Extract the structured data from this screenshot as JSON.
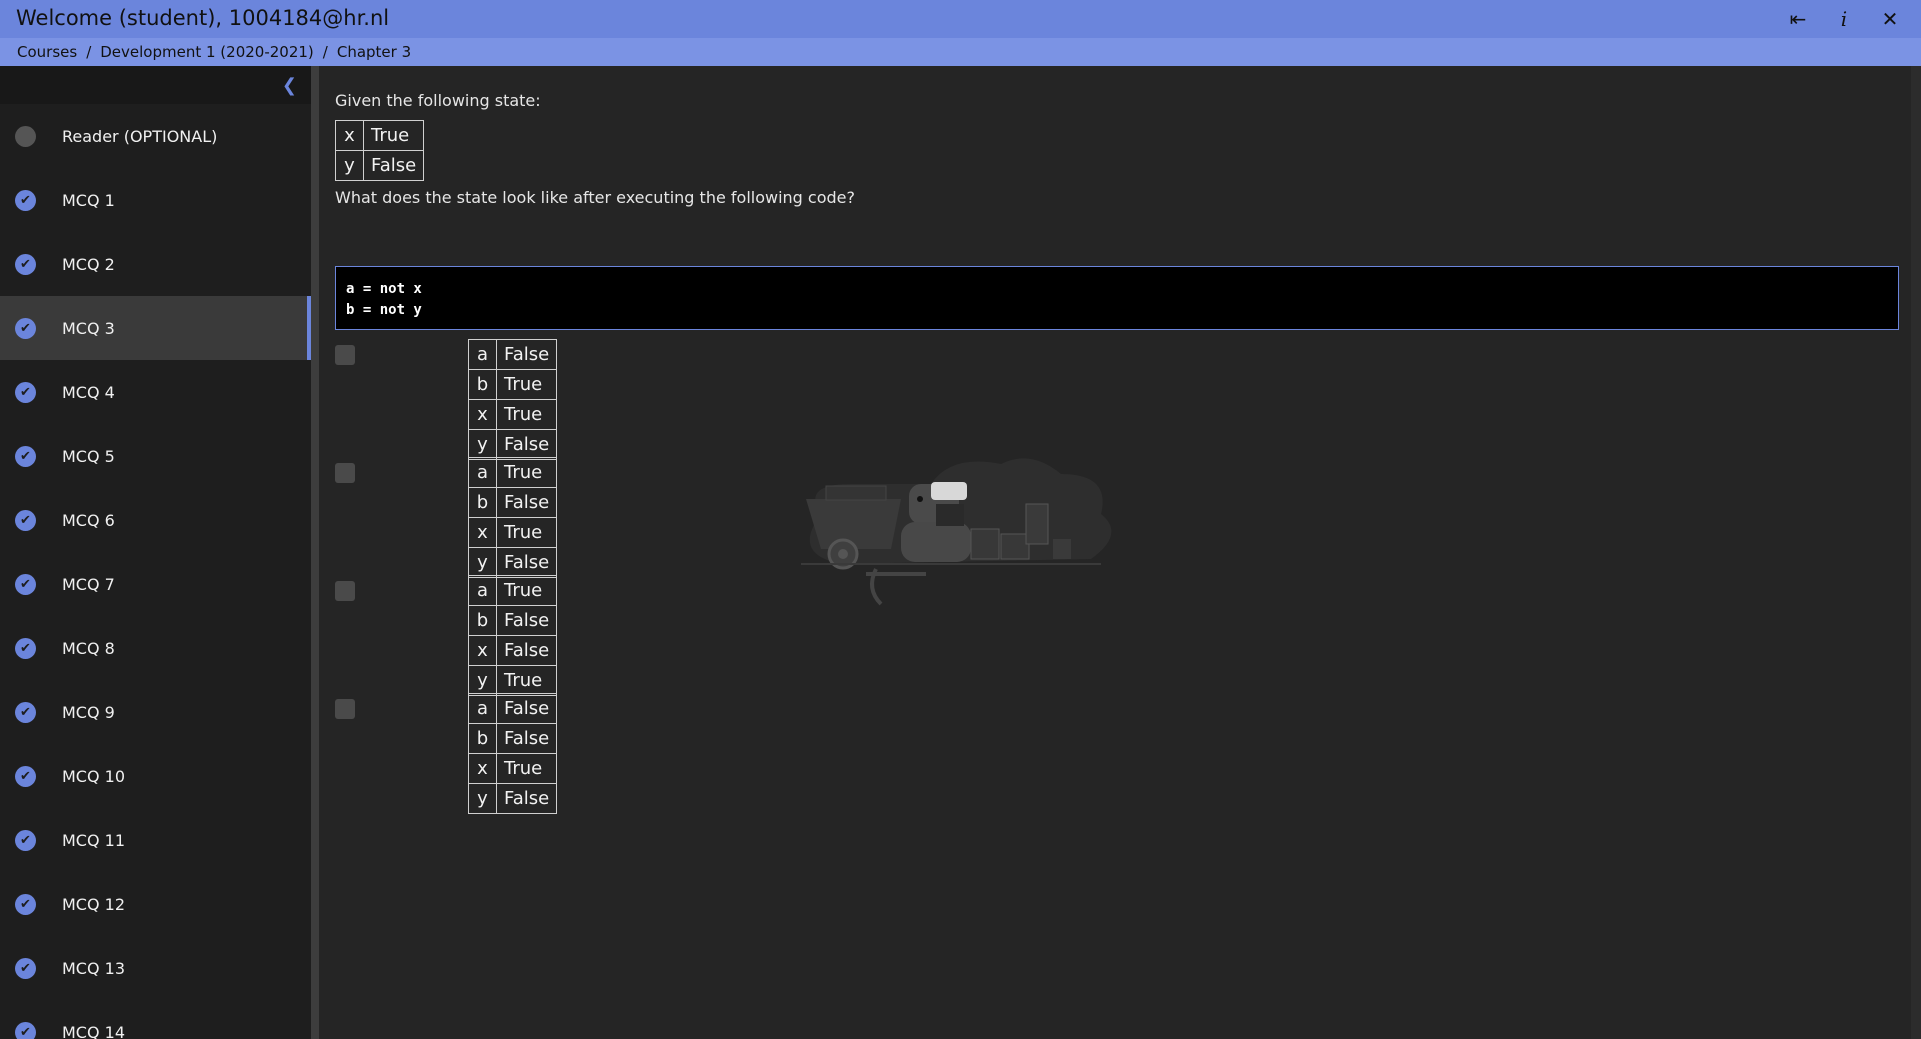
{
  "window": {
    "title": "Welcome (student), 1004184@hr.nl",
    "logout_icon": "logout-icon",
    "info_icon": "info-icon",
    "close_icon": "close-icon"
  },
  "breadcrumb": {
    "items": [
      "Courses",
      "Development 1 (2020-2021)",
      "Chapter 3"
    ],
    "separator": "/"
  },
  "sidebar": {
    "collapse_icon": "chevron-left-icon",
    "items": [
      {
        "label": "Reader (OPTIONAL)",
        "status": "todo"
      },
      {
        "label": "MCQ 1",
        "status": "done"
      },
      {
        "label": "MCQ 2",
        "status": "done"
      },
      {
        "label": "MCQ 3",
        "status": "done",
        "active": true
      },
      {
        "label": "MCQ 4",
        "status": "done"
      },
      {
        "label": "MCQ 5",
        "status": "done"
      },
      {
        "label": "MCQ 6",
        "status": "done"
      },
      {
        "label": "MCQ 7",
        "status": "done"
      },
      {
        "label": "MCQ 8",
        "status": "done"
      },
      {
        "label": "MCQ 9",
        "status": "done"
      },
      {
        "label": "MCQ 10",
        "status": "done"
      },
      {
        "label": "MCQ 11",
        "status": "done"
      },
      {
        "label": "MCQ 12",
        "status": "done"
      },
      {
        "label": "MCQ 13",
        "status": "done"
      },
      {
        "label": "MCQ 14",
        "status": "done"
      }
    ]
  },
  "question": {
    "intro": "Given the following state:",
    "initial_state": [
      [
        "x",
        "True"
      ],
      [
        "y",
        "False"
      ]
    ],
    "prompt": "What does the state look like after executing the following code?",
    "code_lines": [
      "a = not x",
      "b = not y"
    ],
    "options": [
      [
        [
          "a",
          "False"
        ],
        [
          "b",
          "True"
        ],
        [
          "x",
          "True"
        ],
        [
          "y",
          "False"
        ]
      ],
      [
        [
          "a",
          "True"
        ],
        [
          "b",
          "False"
        ],
        [
          "x",
          "True"
        ],
        [
          "y",
          "False"
        ]
      ],
      [
        [
          "a",
          "True"
        ],
        [
          "b",
          "False"
        ],
        [
          "x",
          "False"
        ],
        [
          "y",
          "True"
        ]
      ],
      [
        [
          "a",
          "False"
        ],
        [
          "b",
          "False"
        ],
        [
          "x",
          "True"
        ],
        [
          "y",
          "False"
        ]
      ]
    ]
  },
  "colors": {
    "accent": "#6b85dc",
    "background": "#252525",
    "sidebar": "#1e1e1e"
  }
}
